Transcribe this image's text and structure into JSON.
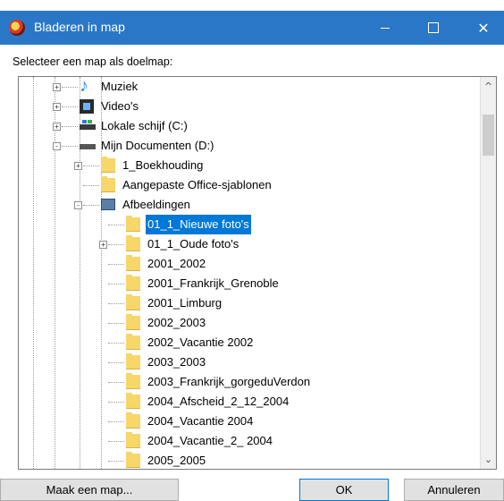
{
  "window": {
    "title": "Bladeren in map",
    "min_glyph": "—",
    "max_glyph": "☐",
    "close_glyph": "✕"
  },
  "caption": "Selecteer een map als doelmap:",
  "tree": {
    "items": [
      {
        "label": "Muziek",
        "icon": "music-icon",
        "level": 1,
        "expander": "+"
      },
      {
        "label": "Video's",
        "icon": "video-icon",
        "level": 1,
        "expander": "+"
      },
      {
        "label": "Lokale schijf (C:)",
        "icon": "drive-icon",
        "level": 1,
        "expander": "+"
      },
      {
        "label": "Mijn Documenten (D:)",
        "icon": "drive-icon",
        "level": 1,
        "expander": "-"
      },
      {
        "label": "1_Boekhouding",
        "icon": "folder-icon",
        "level": 2,
        "expander": "+"
      },
      {
        "label": "Aangepaste Office-sjablonen",
        "icon": "folder-icon",
        "level": 2,
        "expander": ""
      },
      {
        "label": "Afbeeldingen",
        "icon": "pictures-folder-icon",
        "level": 2,
        "expander": "-"
      },
      {
        "label": "01_1_Nieuwe foto's",
        "icon": "folder-icon",
        "level": 3,
        "expander": "",
        "selected": true
      },
      {
        "label": "01_1_Oude foto's",
        "icon": "folder-icon",
        "level": 3,
        "expander": "+"
      },
      {
        "label": "2001_2002",
        "icon": "folder-icon",
        "level": 3,
        "expander": ""
      },
      {
        "label": "2001_Frankrijk_Grenoble",
        "icon": "folder-icon",
        "level": 3,
        "expander": ""
      },
      {
        "label": "2001_Limburg",
        "icon": "folder-icon",
        "level": 3,
        "expander": ""
      },
      {
        "label": "2002_2003",
        "icon": "folder-icon",
        "level": 3,
        "expander": ""
      },
      {
        "label": "2002_Vacantie 2002",
        "icon": "folder-icon",
        "level": 3,
        "expander": ""
      },
      {
        "label": "2003_2003",
        "icon": "folder-icon",
        "level": 3,
        "expander": ""
      },
      {
        "label": "2003_Frankrijk_gorgeduVerdon",
        "icon": "folder-icon",
        "level": 3,
        "expander": ""
      },
      {
        "label": "2004_Afscheid_2_12_2004",
        "icon": "folder-icon",
        "level": 3,
        "expander": ""
      },
      {
        "label": "2004_Vacantie 2004",
        "icon": "folder-icon",
        "level": 3,
        "expander": ""
      },
      {
        "label": "2004_Vacantie_2_ 2004",
        "icon": "folder-icon",
        "level": 3,
        "expander": ""
      },
      {
        "label": "2005_2005",
        "icon": "folder-icon",
        "level": 3,
        "expander": ""
      }
    ]
  },
  "scrollbar": {
    "up": "^",
    "down": "⌄"
  },
  "buttons": {
    "make_folder": "Maak een map...",
    "ok": "OK",
    "cancel": "Annuleren"
  },
  "colors": {
    "titlebar": "#2b77c7",
    "selection": "#0078d7",
    "folder": "#f7d66a"
  }
}
